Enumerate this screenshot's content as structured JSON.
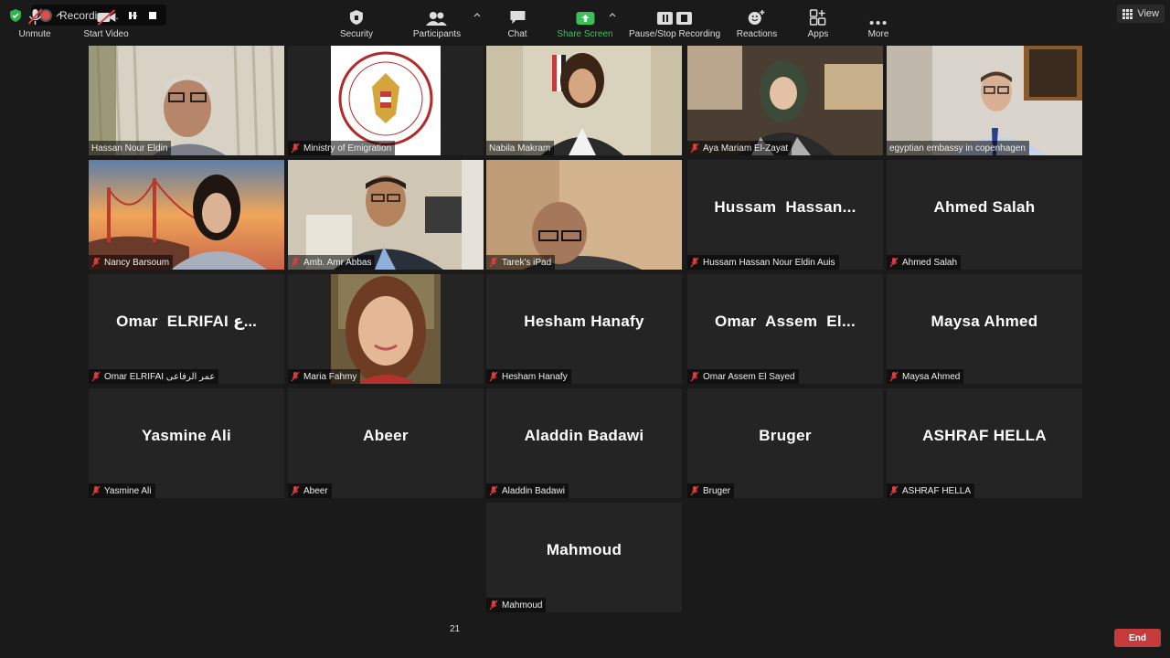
{
  "top": {
    "recording_label": "Recording...",
    "view_label": "View",
    "record_color": "#e04b4b",
    "security_color": "#2fb34a"
  },
  "tiles": [
    {
      "display": "video",
      "name": "Hassan Nour Eldin",
      "muted": false
    },
    {
      "display": "logo",
      "name": "Ministry of Emigration",
      "muted": true
    },
    {
      "display": "video",
      "name": "Nabila Makram",
      "muted": false,
      "active": true
    },
    {
      "display": "video",
      "name": "Aya Mariam El-Zayat",
      "muted": true
    },
    {
      "display": "video",
      "name": "egyptian embassy in copenhagen",
      "muted": false
    },
    {
      "display": "video",
      "name": "Nancy Barsoum",
      "muted": true
    },
    {
      "display": "video",
      "name": "Amb. Amr Abbas",
      "muted": true
    },
    {
      "display": "video",
      "name": "Tarek's iPad",
      "muted": true
    },
    {
      "display": "text",
      "big": "Hussam  Hassan...",
      "name": "Hussam Hassan Nour Eldin Auis",
      "muted": true
    },
    {
      "display": "text",
      "big": "Ahmed Salah",
      "name": "Ahmed Salah",
      "muted": true
    },
    {
      "display": "text",
      "big": "Omar  ELRIFAI ع...",
      "name": "Omar ELRIFAI عمر الرفاعى",
      "muted": true
    },
    {
      "display": "video",
      "name": "Maria Fahmy",
      "muted": true
    },
    {
      "display": "text",
      "big": "Hesham Hanafy",
      "name": "Hesham Hanafy",
      "muted": true
    },
    {
      "display": "text",
      "big": "Omar  Assem  El...",
      "name": "Omar Assem El Sayed",
      "muted": true
    },
    {
      "display": "text",
      "big": "Maysa Ahmed",
      "name": "Maysa Ahmed",
      "muted": true
    },
    {
      "display": "text",
      "big": "Yasmine Ali",
      "name": "Yasmine Ali",
      "muted": true
    },
    {
      "display": "text",
      "big": "Abeer",
      "name": "Abeer",
      "muted": true
    },
    {
      "display": "text",
      "big": "Aladdin Badawi",
      "name": "Aladdin Badawi",
      "muted": true
    },
    {
      "display": "text",
      "big": "Bruger",
      "name": "Bruger",
      "muted": true
    },
    {
      "display": "text",
      "big": "ASHRAF HELLA",
      "name": "ASHRAF HELLA",
      "muted": true
    },
    {
      "display": "text",
      "big": "Mahmoud",
      "name": "Mahmoud",
      "muted": true
    }
  ],
  "toolbar": {
    "unmute": "Unmute",
    "start_video": "Start Video",
    "security": "Security",
    "participants": "Participants",
    "participant_count": "21",
    "chat": "Chat",
    "share_screen": "Share Screen",
    "pause_stop_recording": "Pause/Stop Recording",
    "reactions": "Reactions",
    "apps": "Apps",
    "more": "More",
    "end": "End",
    "share_color": "#3bc15a",
    "end_color": "#c53a3a"
  }
}
